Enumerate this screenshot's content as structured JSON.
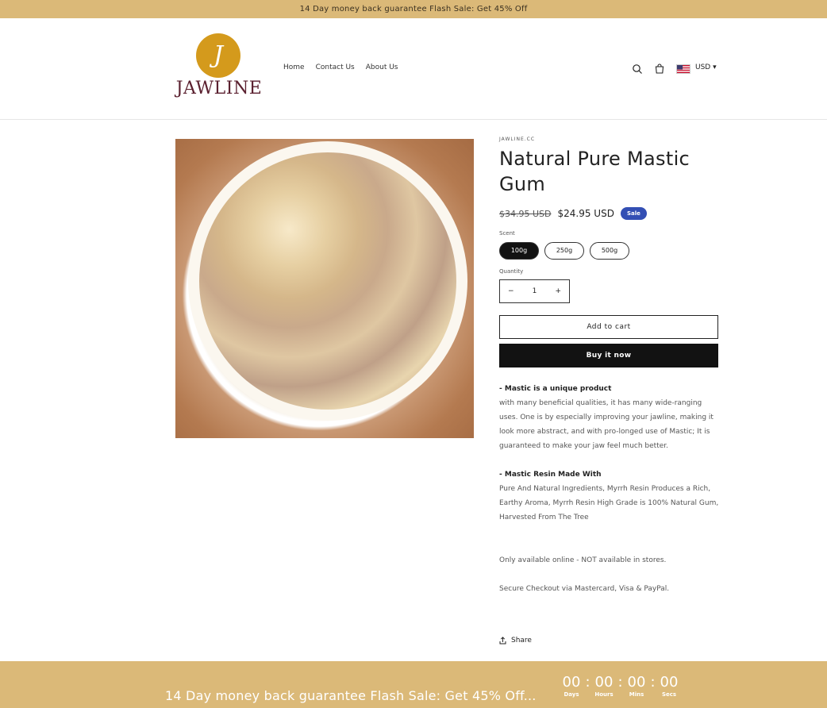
{
  "announcement": "14 Day money back guarantee Flash Sale: Get 45% Off",
  "logo": {
    "letter": "J",
    "text": "JAWLINE"
  },
  "nav": [
    "Home",
    "Contact Us",
    "About Us"
  ],
  "header_icons": {
    "search": "search-icon",
    "cart": "cart-icon",
    "flag": "us-flag-icon"
  },
  "currency": "USD",
  "product": {
    "vendor": "JAWLINE.CC",
    "title": "Natural Pure Mastic Gum",
    "price_old": "$34.95 USD",
    "price_new": "$24.95 USD",
    "badge": "Sale",
    "option_label": "Scent",
    "options": [
      "100g",
      "250g",
      "500g"
    ],
    "quantity_label": "Quantity",
    "quantity": "1",
    "qty_minus": "−",
    "qty_plus": "+",
    "add_to_cart": "Add to cart",
    "buy_now": "Buy it now",
    "desc_h1": "- Mastic is a unique product",
    "desc_p1": "with many beneficial qualities, it has many wide-ranging uses. One is by especially improving your jawline, making it look more abstract, and with pro-longed use of Mastic; It is guaranteed to make your jaw feel much better.",
    "desc_h2": "- Mastic Resin Made With",
    "desc_p2": "Pure And Natural Ingredients, Myrrh Resin Produces a Rich, Earthy Aroma, Myrrh Resin High Grade is 100% Natural Gum, Harvested From The Tree",
    "desc_p3": "Only available online - NOT available in stores.",
    "desc_p4": "Secure Checkout via Mastercard, Visa & PayPal.",
    "share": "Share"
  },
  "footer": {
    "text": "14 Day money back guarantee Flash Sale: Get 45% Off...",
    "timer": [
      {
        "value": "00",
        "label": "Days"
      },
      {
        "value": "00",
        "label": "Hours"
      },
      {
        "value": "00",
        "label": "Mins"
      },
      {
        "value": "00",
        "label": "Secs"
      }
    ],
    "separator": ":"
  },
  "colors": {
    "accent": "#dbb978",
    "sale_badge": "#334fb4",
    "logo_gold": "#d49a1c",
    "logo_text": "#5b2130"
  }
}
